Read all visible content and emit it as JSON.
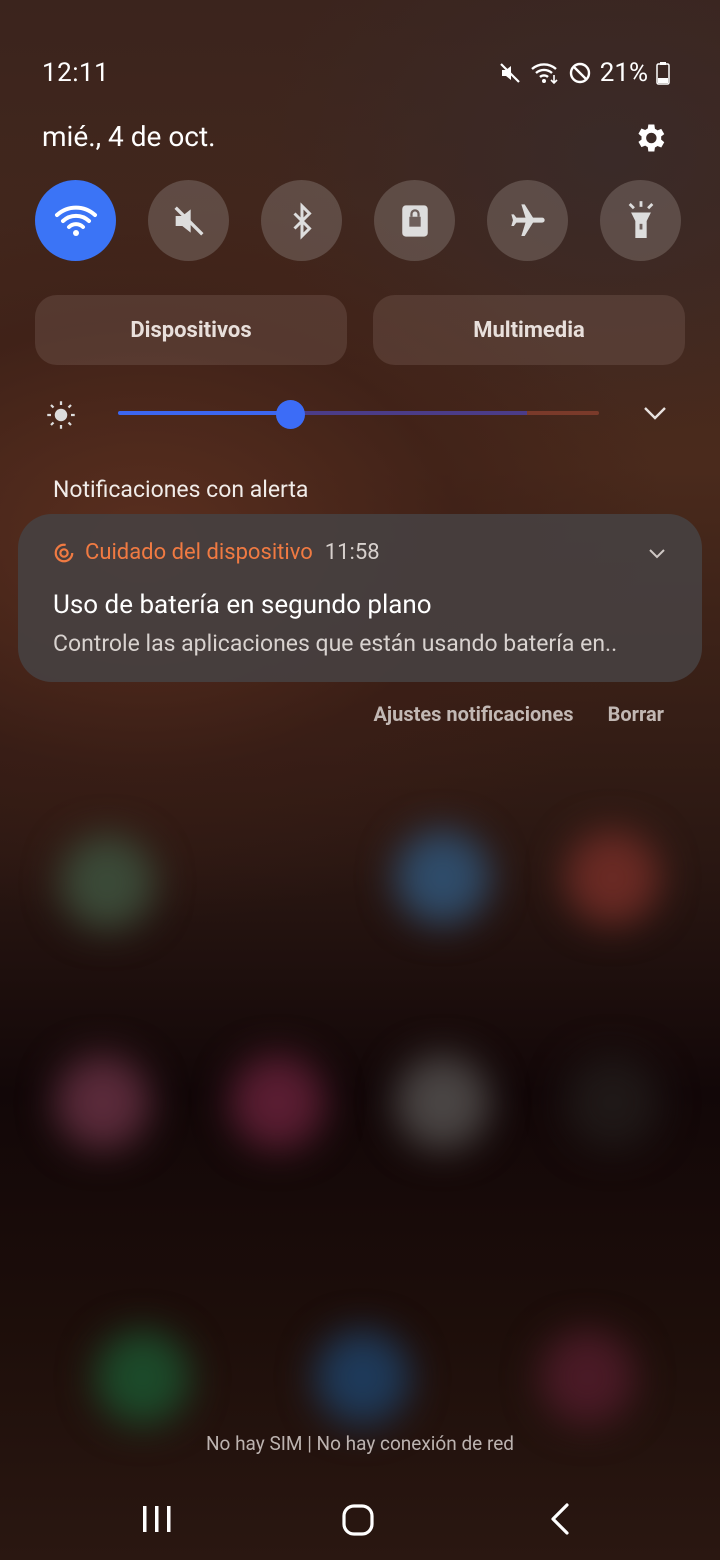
{
  "status_bar": {
    "time": "12:11",
    "battery": "21%",
    "icons": [
      "mute-icon",
      "wifi-icon",
      "do-not-disturb-icon",
      "battery-icon"
    ]
  },
  "header": {
    "date": "mié., 4 de oct."
  },
  "quick_settings": {
    "tiles": [
      {
        "name": "wifi",
        "icon": "wifi-icon",
        "active": true
      },
      {
        "name": "sound",
        "icon": "mute-icon",
        "active": false
      },
      {
        "name": "bluetooth",
        "icon": "bluetooth-icon",
        "active": false
      },
      {
        "name": "rotation-lock",
        "icon": "lock-icon",
        "active": false
      },
      {
        "name": "airplane",
        "icon": "airplane-icon",
        "active": false
      },
      {
        "name": "flashlight",
        "icon": "flashlight-icon",
        "active": false
      }
    ],
    "devices_label": "Dispositivos",
    "media_label": "Multimedia",
    "brightness_level": 0.36
  },
  "notifications": {
    "section_title": "Notificaciones con alerta",
    "card": {
      "app": "Cuidado del dispositivo",
      "time": "11:58",
      "title": "Uso de batería en segundo plano",
      "body": "Controle las aplicaciones que están usando batería en.."
    },
    "settings_label": "Ajustes notificaciones",
    "clear_label": "Borrar"
  },
  "footer": {
    "sim_status": "No hay SIM | No hay conexión de red"
  },
  "colors": {
    "accent": "#3b74f6",
    "app_orange": "#f07a42"
  }
}
